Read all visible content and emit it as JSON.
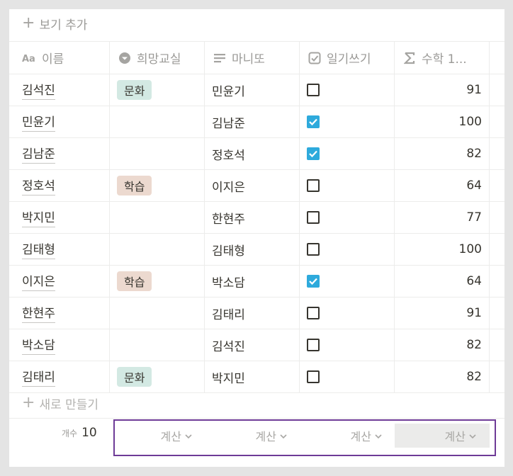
{
  "toolbar": {
    "add_view_label": "보기 추가"
  },
  "columns": [
    {
      "label": "이름",
      "icon": "text-icon"
    },
    {
      "label": "희망교실",
      "icon": "select-icon"
    },
    {
      "label": "마니또",
      "icon": "text-lines-icon"
    },
    {
      "label": "일기쓰기",
      "icon": "checkbox-icon"
    },
    {
      "label": "수학 1...",
      "icon": "sigma-icon"
    }
  ],
  "rows": [
    {
      "name": "김석진",
      "tag": "문화",
      "manito": "민윤기",
      "diary": false,
      "math": "91"
    },
    {
      "name": "민윤기",
      "tag": "",
      "manito": "김남준",
      "diary": true,
      "math": "100"
    },
    {
      "name": "김남준",
      "tag": "",
      "manito": "정호석",
      "diary": true,
      "math": "82"
    },
    {
      "name": "정호석",
      "tag": "학습",
      "manito": "이지은",
      "diary": false,
      "math": "64"
    },
    {
      "name": "박지민",
      "tag": "",
      "manito": "한현주",
      "diary": false,
      "math": "77"
    },
    {
      "name": "김태형",
      "tag": "",
      "manito": "김태형",
      "diary": false,
      "math": "100"
    },
    {
      "name": "이지은",
      "tag": "학습",
      "manito": "박소담",
      "diary": true,
      "math": "64"
    },
    {
      "name": "한현주",
      "tag": "",
      "manito": "김태리",
      "diary": false,
      "math": "91"
    },
    {
      "name": "박소담",
      "tag": "",
      "manito": "김석진",
      "diary": false,
      "math": "82"
    },
    {
      "name": "김태리",
      "tag": "문화",
      "manito": "박지민",
      "diary": false,
      "math": "82"
    }
  ],
  "tag_colors": {
    "문화": "#d3e9e3",
    "학습": "#ecd9cf"
  },
  "checkbox_color": "#2eaadc",
  "new_row_label": "새로 만들기",
  "footer": {
    "count_label": "개수",
    "count_value": "10",
    "calc_labels": [
      "계산",
      "계산",
      "계산",
      "계산"
    ]
  },
  "highlight_color": "#6e3b97"
}
